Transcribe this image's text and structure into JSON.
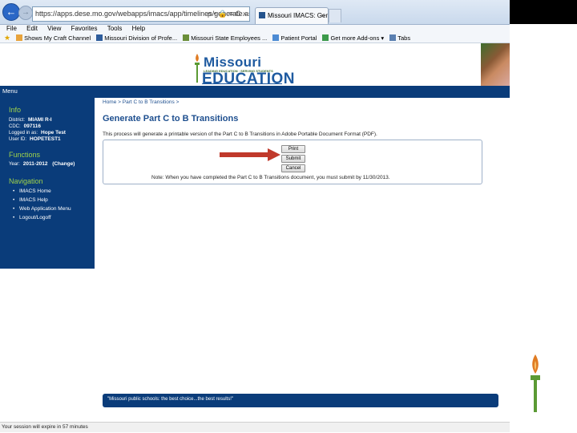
{
  "browser": {
    "address": "https://apps.dese.mo.gov/webapps/imacs/app/timelines/generate.asp",
    "address_controls": "ρ • 🔒 ≡ C ×",
    "tab_title": "Missouri IMACS: Generate ...",
    "tab_close": "×",
    "back_icon": "←",
    "forward_icon": "→"
  },
  "menu": [
    "File",
    "Edit",
    "View",
    "Favorites",
    "Tools",
    "Help"
  ],
  "favorites": [
    {
      "label": "Shows My Craft Channel",
      "icon": "star-icon"
    },
    {
      "label": "Missouri Division of Profe...",
      "icon": "page-icon"
    },
    {
      "label": "Missouri State Employees ...",
      "icon": "page-icon"
    },
    {
      "label": "Patient Portal",
      "icon": "page-icon"
    },
    {
      "label": "Get more Add-ons ▾",
      "icon": "page-icon"
    },
    {
      "label": "Tabs",
      "icon": "page-icon"
    }
  ],
  "banner": {
    "logo_top": "Missouri",
    "logo_tag": "LEADING EDUCATION · SERVING STUDENTS",
    "logo_main": "EDUCATION"
  },
  "nav": {
    "menu_label": "Menu"
  },
  "sidebar": {
    "info_heading": "Info",
    "district_label": "District:",
    "district_value": "MIAMI R-I",
    "cdc_label": "CDC:",
    "cdc_value": "097116",
    "logged_label": "Logged in as:",
    "logged_value": "Hope Test",
    "userid_label": "User ID:",
    "userid_value": "HOPETEST1",
    "functions_heading": "Functions",
    "year_label": "Year:",
    "year_value": "2011-2012",
    "year_change": "(Change)",
    "navigation_heading": "Navigation",
    "nav_links": [
      "IMACS Home",
      "IMACS Help",
      "Web Application Menu",
      "Logout/Logoff"
    ]
  },
  "main": {
    "breadcrumb": "Home > Part C to B Transitions >",
    "title": "Generate Part C to B Transitions",
    "description": "This process will generate a printable version of the Part C to B Transitions in Adobe Portable Document Format (PDF).",
    "buttons": {
      "print": "Print",
      "submit": "Submit",
      "cancel": "Cancel"
    },
    "note": "Note: When you have completed the Part C to B Transitions document, you must submit by 11/30/2013."
  },
  "footer": {
    "slogan": "\"Missouri public schools: the best choice...the best results!\""
  },
  "statusbar": {
    "text": "Your session will expire in 57 minutes"
  },
  "colors": {
    "navy": "#0a3c7a",
    "accent_green": "#9fd24a",
    "title_blue": "#1e4f8f",
    "arrow_red": "#c0392b"
  }
}
